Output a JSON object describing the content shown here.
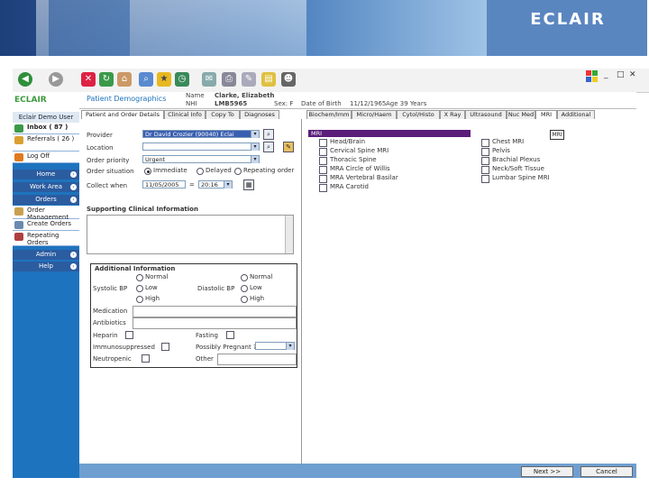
{
  "brand": "ECLAIR",
  "toolbar": {
    "window_controls": [
      "_",
      "□",
      "✕"
    ]
  },
  "nav": {
    "logo": "ECLAIR",
    "user_header": "Eclair Demo User",
    "inbox": "Inbox ( 87 )",
    "referrals": "Referrals ( 26 )",
    "logoff": "Log Off",
    "sections": [
      "Home",
      "Work Area",
      "Orders"
    ],
    "order_management": "Order Management",
    "create_orders": "Create Orders",
    "repeating_orders": "Repeating Orders",
    "admin": "Admin",
    "help": "Help"
  },
  "patient": {
    "title": "Patient Demographics",
    "name_label": "Name",
    "name_value": "Clarke, Elizabeth",
    "nhi_label": "NHI",
    "nhi_value": "LMB5965",
    "sex": "Sex: F",
    "dob_label": "Date of Birth",
    "dob_value": "11/12/1965",
    "age": "Age 39 Years"
  },
  "tabs_left": [
    "Patient and Order Details",
    "Clinical Info",
    "Copy To",
    "Diagnoses"
  ],
  "tabs_right": [
    "Biochem/Imm",
    "Micro/Haem",
    "Cytol/Histo",
    "X Ray",
    "Ultrasound",
    "Nuc Med",
    "MRI",
    "Additional"
  ],
  "order": {
    "provider_label": "Provider",
    "provider_value": "Dr David Crozier (90040) Eclai",
    "location_label": "Location",
    "priority_label": "Order priority",
    "priority_value": "Urgent",
    "situation_label": "Order situation",
    "situation_options": [
      "Immediate",
      "Delayed",
      "Repeating order"
    ],
    "collect_label": "Collect when",
    "collect_date": "11/05/2005",
    "collect_time": "20:16",
    "supporting_title": "Supporting Clinical Information"
  },
  "additional": {
    "title": "Additional Information",
    "systolic_label": "Systolic BP",
    "systolic_options": [
      "Normal",
      "Low",
      "High"
    ],
    "diastolic_label": "Diastolic BP",
    "diastolic_options": [
      "Normal",
      "Low",
      "High"
    ],
    "medication_label": "Medication",
    "antibiotics_label": "Antibiotics",
    "heparin_label": "Heparin",
    "fasting_label": "Fasting",
    "immuno_label": "Immunosuppressed",
    "pregnant_label": "Possibly Pregnant ?",
    "neutropenic_label": "Neutropenic",
    "other_label": "Other"
  },
  "mri": {
    "header": "MRI",
    "box_label": "MRI",
    "col1": [
      "Head/Brain",
      "Cervical Spine MRI",
      "Thoracic Spine",
      "MRA Circle of Willis",
      "MRA Vertebral Basilar",
      "MRA Carotid"
    ],
    "col2": [
      "Chest MRI",
      "Pelvis",
      "Brachial Plexus",
      "Neck/Soft Tissue",
      "Lumbar Spine MRI"
    ]
  },
  "footer": {
    "next": "Next >>",
    "cancel": "Cancel"
  }
}
